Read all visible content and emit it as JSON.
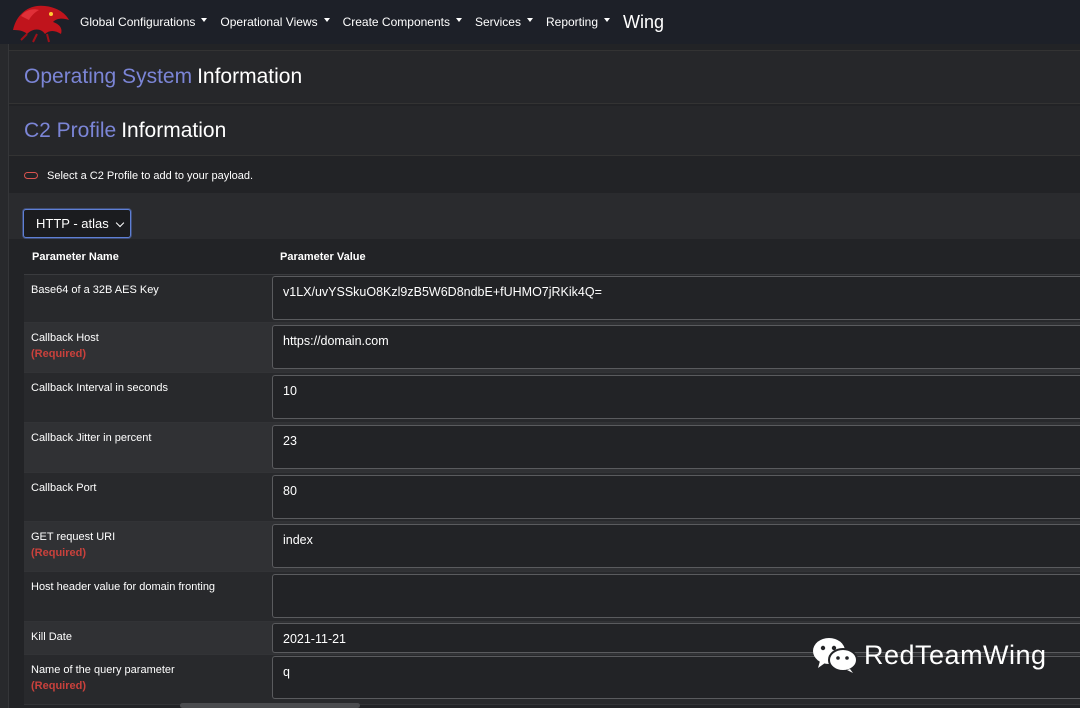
{
  "navbar": {
    "items": [
      {
        "label": "Global Configurations"
      },
      {
        "label": "Operational Views"
      },
      {
        "label": "Create Components"
      },
      {
        "label": "Services"
      },
      {
        "label": "Reporting"
      }
    ],
    "brand": "Wing"
  },
  "os_section": {
    "accent": "Operating System",
    "rest": "Information"
  },
  "c2_section": {
    "accent": "C2 Profile",
    "rest": "Information"
  },
  "note": "Select a C2 Profile to add to your payload.",
  "profile_select": {
    "value": "HTTP - atlas"
  },
  "table": {
    "headers": {
      "name": "Parameter Name",
      "value": "Parameter Value"
    },
    "required_label": "(Required)",
    "rows": [
      {
        "name": "Base64 of a 32B AES Key",
        "value": "v1LX/uvYSSkuO8Kzl9zB5W6D8ndbE+fUHMO7jRKik4Q="
      },
      {
        "name": "Callback Host",
        "value": "https://domain.com",
        "required": true
      },
      {
        "name": "Callback Interval in seconds",
        "value": "10"
      },
      {
        "name": "Callback Jitter in percent",
        "value": "23"
      },
      {
        "name": "Callback Port",
        "value": "80"
      },
      {
        "name": "GET request URI",
        "value": "index",
        "required": true
      },
      {
        "name": "Host header value for domain fronting",
        "value": ""
      },
      {
        "name": "Kill Date",
        "value": "2021-11-21"
      },
      {
        "name": "Name of the query parameter",
        "value": "q",
        "required": true
      }
    ]
  },
  "watermark": "RedTeamWing",
  "colors": {
    "accent": "#7b85d6",
    "required": "#c9413c",
    "navbar": "#1d2028",
    "focus": "#5e7fd6"
  }
}
